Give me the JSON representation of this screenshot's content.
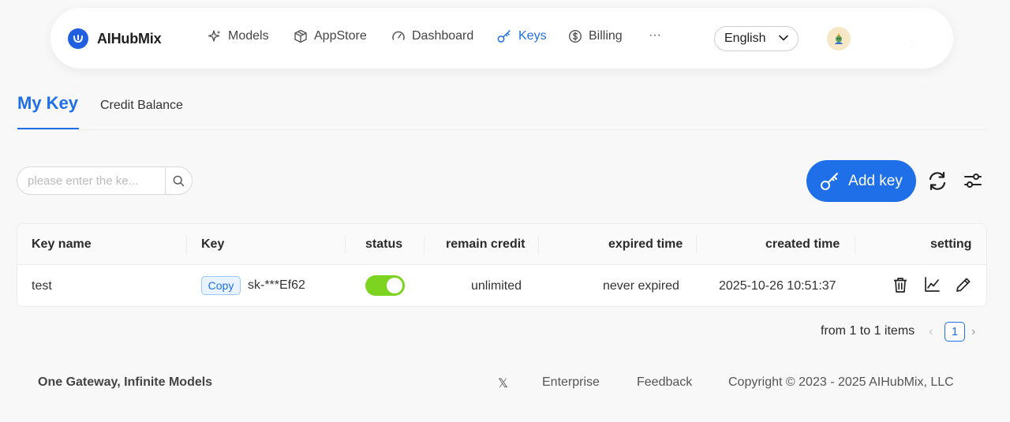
{
  "brand": {
    "name": "AIHubMix",
    "accent": "#1f6fe8"
  },
  "nav": {
    "items": [
      {
        "label": "Models",
        "icon": "sparkle-icon"
      },
      {
        "label": "AppStore",
        "icon": "box-icon"
      },
      {
        "label": "Dashboard",
        "icon": "gauge-icon"
      },
      {
        "label": "Keys",
        "icon": "key-icon",
        "active": true
      },
      {
        "label": "Billing",
        "icon": "dollar-circle-icon"
      }
    ],
    "more": "···",
    "language": "English",
    "avatar_icon": "avatar-icon"
  },
  "tabs": {
    "my_key": "My Key",
    "credit_balance": "Credit Balance"
  },
  "search": {
    "placeholder": "please enter the ke..."
  },
  "actions": {
    "add_key": "Add key"
  },
  "table": {
    "headers": {
      "key_name": "Key name",
      "key": "Key",
      "status": "status",
      "remain_credit": "remain credit",
      "expired_time": "expired time",
      "created_time": "created time",
      "setting": "setting"
    },
    "rows": [
      {
        "key_name": "test",
        "copy": "Copy",
        "key": "sk-***Ef62",
        "status_on": true,
        "remain_credit": "unlimited",
        "expired_time": "never expired",
        "created_time": "2025-10-26 10:51:37"
      }
    ]
  },
  "pagination": {
    "summary": "from 1 to 1 items",
    "current": "1",
    "prev": "‹",
    "next": "›"
  },
  "footer": {
    "tagline": "One Gateway, Infinite Models",
    "x_label": "𝕏",
    "enterprise": "Enterprise",
    "feedback": "Feedback",
    "copyright": "Copyright © 2023 - 2025 AIHubMix, LLC"
  }
}
